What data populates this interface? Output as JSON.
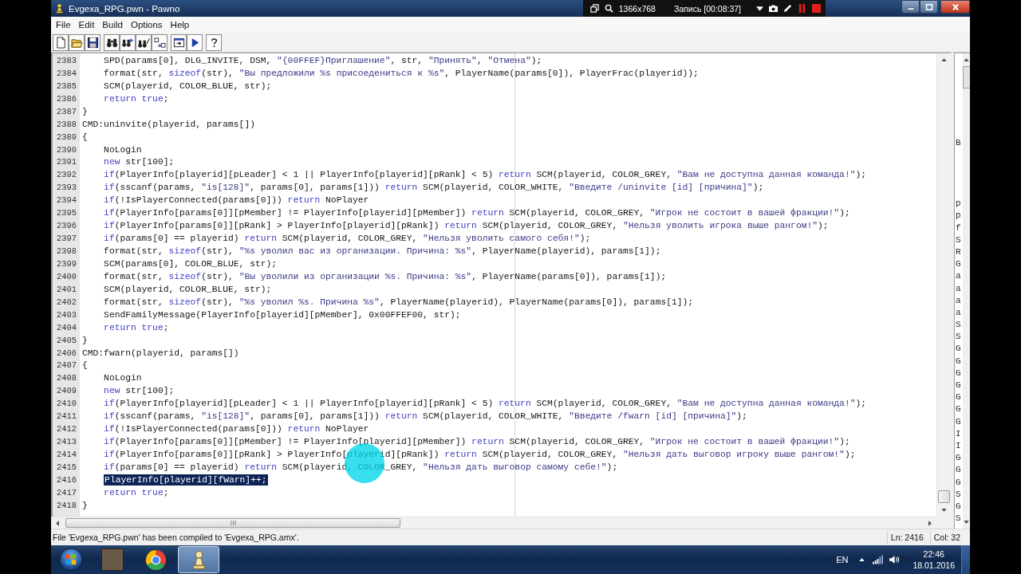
{
  "window": {
    "title": "Evgexa_RPG.pwn - Pawno"
  },
  "recorder": {
    "resolution": "1366x768",
    "status": "Запись [00:08:37]"
  },
  "menu": [
    "File",
    "Edit",
    "Build",
    "Options",
    "Help"
  ],
  "editor": {
    "lines": [
      {
        "children": [
          {
            "number": "2383",
            "tokens": [
              {
                "kind": "plain",
                "text": "SPD(params[0], DLG_INVITE, DSM, "
              },
              {
                "kind": "string",
                "text": "\"{00FFEF}Приглашение\""
              },
              {
                "kind": "plain",
                "text": ", str, "
              },
              {
                "kind": "string",
                "text": "\"Принять\""
              },
              {
                "kind": "plain",
                "text": ", "
              },
              {
                "kind": "string",
                "text": "\"Отмена\""
              },
              {
                "kind": "plain",
                "text": ");"
              }
            ]
          },
          {
            "number": "2384",
            "tokens": [
              {
                "kind": "plain",
                "text": "format(str, "
              },
              {
                "kind": "keyword",
                "text": "sizeof"
              },
              {
                "kind": "plain",
                "text": "(str), "
              },
              {
                "kind": "string",
                "text": "\"Вы предложили %s присоедениться к %s\""
              },
              {
                "kind": "plain",
                "text": ", PlayerName(params[0]), PlayerFrac(playerid));"
              }
            ]
          },
          {
            "number": "2385",
            "tokens": [
              {
                "kind": "plain",
                "text": "SCM(playerid, COLOR_BLUE, str);"
              }
            ]
          },
          {
            "number": "2386",
            "tokens": [
              {
                "kind": "keyword",
                "text": "return true"
              },
              {
                "kind": "plain",
                "text": ";"
              }
            ]
          }
        ]
      },
      {
        "number": "2387",
        "tokens": [
          {
            "kind": "plain",
            "text": "}"
          }
        ]
      },
      {
        "number": "2388",
        "tokens": [
          {
            "kind": "plain",
            "text": "CMD:uninvite(playerid, params[])"
          }
        ]
      },
      {
        "number": "2389",
        "tokens": [
          {
            "kind": "plain",
            "text": "{"
          }
        ],
        "children": [
          {
            "number": "2390",
            "tokens": [
              {
                "kind": "plain",
                "text": "NoLogin"
              }
            ]
          },
          {
            "number": "2391",
            "tokens": [
              {
                "kind": "keyword",
                "text": "new"
              },
              {
                "kind": "plain",
                "text": " str[100];"
              }
            ]
          },
          {
            "number": "2392",
            "tokens": [
              {
                "kind": "keyword",
                "text": "if"
              },
              {
                "kind": "plain",
                "text": "(PlayerInfo[playerid][pLeader] < 1 || PlayerInfo[playerid][pRank] < 5) "
              },
              {
                "kind": "keyword",
                "text": "return"
              },
              {
                "kind": "plain",
                "text": " SCM(playerid, COLOR_GREY, "
              },
              {
                "kind": "string",
                "text": "\"Вам не доступна данная команда!\""
              },
              {
                "kind": "plain",
                "text": ");"
              }
            ]
          },
          {
            "number": "2393",
            "tokens": [
              {
                "kind": "keyword",
                "text": "if"
              },
              {
                "kind": "plain",
                "text": "(sscanf(params, "
              },
              {
                "kind": "string",
                "text": "\"is[128]\""
              },
              {
                "kind": "plain",
                "text": ", params[0], params[1])) "
              },
              {
                "kind": "keyword",
                "text": "return"
              },
              {
                "kind": "plain",
                "text": " SCM(playerid, COLOR_WHITE, "
              },
              {
                "kind": "string",
                "text": "\"Введите /uninvite [id] [причина]\""
              },
              {
                "kind": "plain",
                "text": ");"
              }
            ]
          },
          {
            "number": "2394",
            "tokens": [
              {
                "kind": "keyword",
                "text": "if"
              },
              {
                "kind": "plain",
                "text": "(!IsPlayerConnected(params[0])) "
              },
              {
                "kind": "keyword",
                "text": "return"
              },
              {
                "kind": "plain",
                "text": " NoPlayer"
              }
            ]
          },
          {
            "number": "2395",
            "tokens": [
              {
                "kind": "keyword",
                "text": "if"
              },
              {
                "kind": "plain",
                "text": "(PlayerInfo[params[0]][pMember] != PlayerInfo[playerid][pMember]) "
              },
              {
                "kind": "keyword",
                "text": "return"
              },
              {
                "kind": "plain",
                "text": " SCM(playerid, COLOR_GREY, "
              },
              {
                "kind": "string",
                "text": "\"Игрок не состоит в вашей фракции!\""
              },
              {
                "kind": "plain",
                "text": ");"
              }
            ]
          },
          {
            "number": "2396",
            "tokens": [
              {
                "kind": "keyword",
                "text": "if"
              },
              {
                "kind": "plain",
                "text": "(PlayerInfo[params[0]][pRank] > PlayerInfo[playerid][pRank]) "
              },
              {
                "kind": "keyword",
                "text": "return"
              },
              {
                "kind": "plain",
                "text": " SCM(playerid, COLOR_GREY, "
              },
              {
                "kind": "string",
                "text": "\"Нельзя уволить игрока выше рангом!\""
              },
              {
                "kind": "plain",
                "text": ");"
              }
            ]
          },
          {
            "number": "2397",
            "tokens": [
              {
                "kind": "keyword",
                "text": "if"
              },
              {
                "kind": "plain",
                "text": "(params[0] == playerid) "
              },
              {
                "kind": "keyword",
                "text": "return"
              },
              {
                "kind": "plain",
                "text": " SCM(playerid, COLOR_GREY, "
              },
              {
                "kind": "string",
                "text": "\"Нельзя уволить самого себя!\""
              },
              {
                "kind": "plain",
                "text": ");"
              }
            ]
          },
          {
            "number": "2398",
            "tokens": [
              {
                "kind": "plain",
                "text": "format(str, "
              },
              {
                "kind": "keyword",
                "text": "sizeof"
              },
              {
                "kind": "plain",
                "text": "(str), "
              },
              {
                "kind": "string",
                "text": "\"%s уволил вас из организации. Причина: %s\""
              },
              {
                "kind": "plain",
                "text": ", PlayerName(playerid), params[1]);"
              }
            ]
          },
          {
            "number": "2399",
            "tokens": [
              {
                "kind": "plain",
                "text": "SCM(params[0], COLOR_BLUE, str);"
              }
            ]
          },
          {
            "number": "2400",
            "tokens": [
              {
                "kind": "plain",
                "text": "format(str, "
              },
              {
                "kind": "keyword",
                "text": "sizeof"
              },
              {
                "kind": "plain",
                "text": "(str), "
              },
              {
                "kind": "string",
                "text": "\"Вы уволили из организации %s. Причина: %s\""
              },
              {
                "kind": "plain",
                "text": ", PlayerName(params[0]), params[1]);"
              }
            ]
          },
          {
            "number": "2401",
            "tokens": [
              {
                "kind": "plain",
                "text": "SCM(playerid, COLOR_BLUE, str);"
              }
            ]
          },
          {
            "number": "2402",
            "tokens": [
              {
                "kind": "plain",
                "text": "format(str, "
              },
              {
                "kind": "keyword",
                "text": "sizeof"
              },
              {
                "kind": "plain",
                "text": "(str), "
              },
              {
                "kind": "string",
                "text": "\"%s уволил %s. Причина %s\""
              },
              {
                "kind": "plain",
                "text": ", PlayerName(playerid), PlayerName(params[0]), params[1]);"
              }
            ]
          },
          {
            "number": "2403",
            "tokens": [
              {
                "kind": "plain",
                "text": "SendFamilyMessage(PlayerInfo[playerid][pMember], 0x00FFEF00, str);"
              }
            ]
          },
          {
            "number": "2404",
            "tokens": [
              {
                "kind": "keyword",
                "text": "return true"
              },
              {
                "kind": "plain",
                "text": ";"
              }
            ]
          }
        ]
      },
      {
        "number": "2405",
        "tokens": [
          {
            "kind": "plain",
            "text": "}"
          }
        ]
      },
      {
        "number": "2406",
        "tokens": [
          {
            "kind": "plain",
            "text": "CMD:fwarn(playerid, params[])"
          }
        ]
      },
      {
        "number": "2407",
        "tokens": [
          {
            "kind": "plain",
            "text": "{"
          }
        ],
        "children": [
          {
            "number": "2408",
            "tokens": [
              {
                "kind": "plain",
                "text": "NoLogin"
              }
            ]
          },
          {
            "number": "2409",
            "tokens": [
              {
                "kind": "keyword",
                "text": "new"
              },
              {
                "kind": "plain",
                "text": " str[100];"
              }
            ]
          },
          {
            "number": "2410",
            "tokens": [
              {
                "kind": "keyword",
                "text": "if"
              },
              {
                "kind": "plain",
                "text": "(PlayerInfo[playerid][pLeader] < 1 || PlayerInfo[playerid][pRank] < 5) "
              },
              {
                "kind": "keyword",
                "text": "return"
              },
              {
                "kind": "plain",
                "text": " SCM(playerid, COLOR_GREY, "
              },
              {
                "kind": "string",
                "text": "\"Вам не доступна данная команда!\""
              },
              {
                "kind": "plain",
                "text": ");"
              }
            ]
          },
          {
            "number": "2411",
            "tokens": [
              {
                "kind": "keyword",
                "text": "if"
              },
              {
                "kind": "plain",
                "text": "(sscanf(params, "
              },
              {
                "kind": "string",
                "text": "\"is[128]\""
              },
              {
                "kind": "plain",
                "text": ", params[0], params[1])) "
              },
              {
                "kind": "keyword",
                "text": "return"
              },
              {
                "kind": "plain",
                "text": " SCM(playerid, COLOR_WHITE, "
              },
              {
                "kind": "string",
                "text": "\"Введите /fwarn [id] [причина]\""
              },
              {
                "kind": "plain",
                "text": ");"
              }
            ]
          },
          {
            "number": "2412",
            "tokens": [
              {
                "kind": "keyword",
                "text": "if"
              },
              {
                "kind": "plain",
                "text": "(!IsPlayerConnected(params[0])) "
              },
              {
                "kind": "keyword",
                "text": "return"
              },
              {
                "kind": "plain",
                "text": " NoPlayer"
              }
            ]
          },
          {
            "number": "2413",
            "tokens": [
              {
                "kind": "keyword",
                "text": "if"
              },
              {
                "kind": "plain",
                "text": "(PlayerInfo[params[0]][pMember] != PlayerInfo[playerid][pMember]) "
              },
              {
                "kind": "keyword",
                "text": "return"
              },
              {
                "kind": "plain",
                "text": " SCM(playerid, COLOR_GREY, "
              },
              {
                "kind": "string",
                "text": "\"Игрок не состоит в вашей фракции!\""
              },
              {
                "kind": "plain",
                "text": ");"
              }
            ]
          },
          {
            "number": "2414",
            "tokens": [
              {
                "kind": "keyword",
                "text": "if"
              },
              {
                "kind": "plain",
                "text": "(PlayerInfo[params[0]][pRank] > PlayerInfo[playerid][pRank]) "
              },
              {
                "kind": "keyword",
                "text": "return"
              },
              {
                "kind": "plain",
                "text": " SCM(playerid, COLOR_GREY, "
              },
              {
                "kind": "string",
                "text": "\"Нельзя дать выговор игроку выше рангом!\""
              },
              {
                "kind": "plain",
                "text": ");"
              }
            ]
          },
          {
            "number": "2415",
            "tokens": [
              {
                "kind": "keyword",
                "text": "if"
              },
              {
                "kind": "plain",
                "text": "(params[0] == playerid) "
              },
              {
                "kind": "keyword",
                "text": "return"
              },
              {
                "kind": "plain",
                "text": " SCM(playerid, COLOR_GREY, "
              },
              {
                "kind": "string",
                "text": "\"Нельзя дать выговор самому себе!\""
              },
              {
                "kind": "plain",
                "text": ");"
              }
            ]
          },
          {
            "number": "2416",
            "tokens": [
              {
                "kind": "selection",
                "text": "PlayerInfo[playerid][fWarn]++;"
              }
            ]
          },
          {
            "number": "2417",
            "tokens": [
              {
                "kind": "keyword",
                "text": "return true"
              },
              {
                "kind": "plain",
                "text": ";"
              }
            ]
          }
        ]
      },
      {
        "number": "2418",
        "tokens": [
          {
            "kind": "plain",
            "text": "}"
          }
        ]
      }
    ]
  },
  "function_list": {
    "groups": [
      [
        "B"
      ],
      [
        "p",
        "p",
        "f",
        "S",
        "R",
        "G",
        "a",
        "a",
        "a",
        "a",
        "S",
        "S",
        "G",
        "G",
        "G",
        "G",
        "G",
        "G",
        "G",
        "I",
        "I",
        "G",
        "G",
        "G",
        "S",
        "G",
        "S"
      ]
    ]
  },
  "status_bar": {
    "message": "File 'Evgexa_RPG.pwn' has been compiled to 'Evgexa_RPG.amx'.",
    "line": "Ln: 2416",
    "column": "Col: 32"
  },
  "taskbar": {
    "apps": [
      {
        "selected": false
      },
      {
        "selected": false
      },
      {
        "selected": true
      }
    ],
    "language": "EN",
    "time": "22:46",
    "date": "18.01.2016"
  }
}
